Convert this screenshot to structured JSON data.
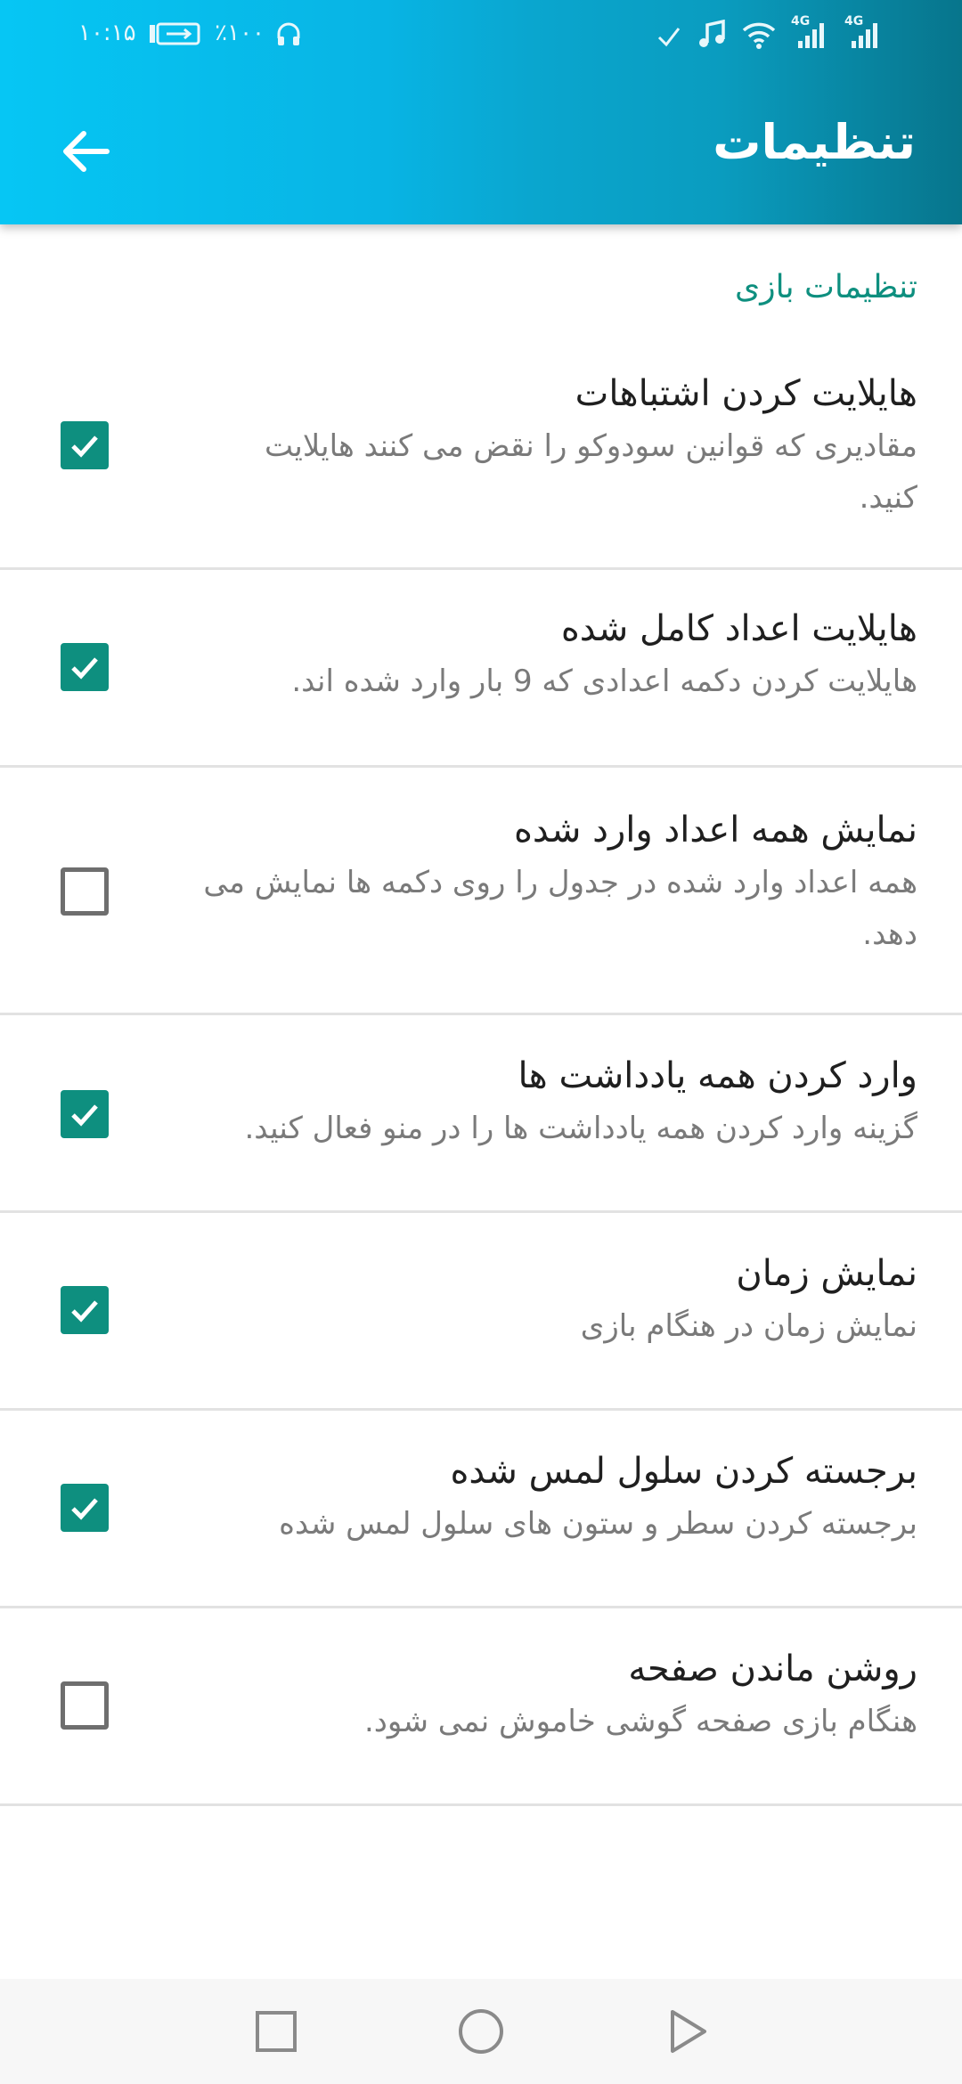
{
  "status_bar": {
    "time": "۱۰:۱۵",
    "battery": "٪۱۰۰",
    "network_1": "4G",
    "network_2": "4G"
  },
  "app_bar": {
    "title": "تنظیمات",
    "back_icon": "arrow-left-icon"
  },
  "section": {
    "header": "تنظیمات بازی"
  },
  "settings": [
    {
      "title": "هایلایت کردن اشتباهات",
      "desc_line1": "مقادیری که قوانین سودوکو را نقض می کنند هایلایت",
      "desc_line2": "کنید.",
      "checked": true
    },
    {
      "title": "هایلایت اعداد کامل شده",
      "desc_line1": "هایلایت کردن دکمه اعدادی که 9 بار وارد شده اند.",
      "desc_line2": "",
      "checked": true
    },
    {
      "title": "نمایش همه اعداد وارد شده",
      "desc_line1": "همه اعداد وارد شده در جدول را روی دکمه ها نمایش می",
      "desc_line2": "دهد.",
      "checked": false
    },
    {
      "title": "وارد کردن همه یادداشت ها",
      "desc_line1": "گزینه وارد کردن همه یادداشت ها را در منو فعال کنید.",
      "desc_line2": "",
      "checked": true
    },
    {
      "title": "نمایش زمان",
      "desc_line1": "نمایش زمان در هنگام بازی",
      "desc_line2": "",
      "checked": true
    },
    {
      "title": "برجسته کردن سلول لمس شده",
      "desc_line1": "برجسته کردن سطر و ستون های سلول لمس شده",
      "desc_line2": "",
      "checked": true
    },
    {
      "title": "روشن ماندن صفحه",
      "desc_line1": "هنگام بازی صفحه گوشی خاموش نمی شود.",
      "desc_line2": "",
      "checked": false
    }
  ],
  "nav_bar": {
    "recents_icon": "square-icon",
    "home_icon": "circle-icon",
    "back_icon": "triangle-back-icon"
  },
  "colors": {
    "accent": "#0e8f7f",
    "app_bar_start": "#06c6f4",
    "app_bar_end": "#07758c"
  }
}
